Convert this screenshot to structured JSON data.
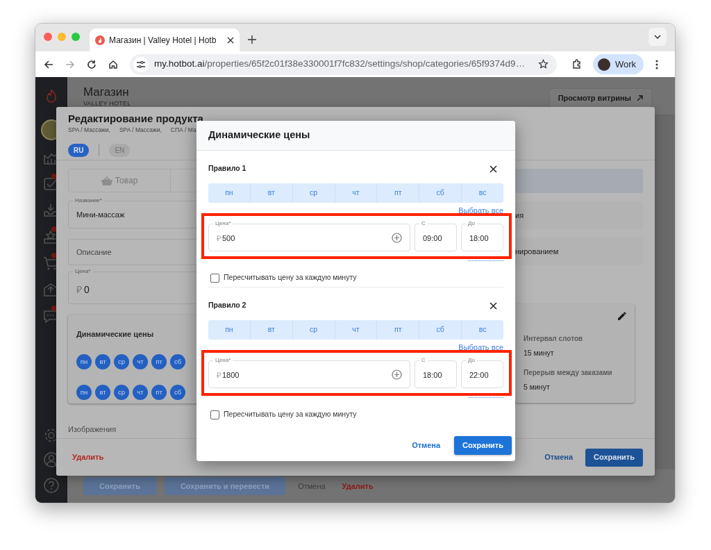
{
  "browser": {
    "tab_title": "Магазин | Valley Hotel | Hotb",
    "url_host": "my.hotbot.ai",
    "url_path": "/properties/65f2c01f38e330001f7fc832/settings/shop/categories/65f9374d9…",
    "profile": "Work"
  },
  "sidebar": {
    "items": [
      {
        "kind": "chart",
        "badge": false
      },
      {
        "kind": "check",
        "badge": true
      },
      {
        "kind": "inbox",
        "badge": false
      },
      {
        "kind": "star",
        "badge": true
      },
      {
        "kind": "cart",
        "badge": true
      },
      {
        "kind": "outbox",
        "badge": false
      },
      {
        "kind": "chat",
        "badge": true
      }
    ]
  },
  "page": {
    "title": "Магазин",
    "subtitle": "VALLEY HOTEL",
    "storefront_button": "Просмотр витрины",
    "actions": [
      {
        "label": "Сохранить",
        "kind": "primary"
      },
      {
        "label": "Сохранить и перевести",
        "kind": "primary"
      },
      {
        "label": "Отмена",
        "kind": "plain"
      },
      {
        "label": "Удалить",
        "kind": "danger"
      }
    ]
  },
  "edit_modal": {
    "title": "Редактирование продукта",
    "breadcrumbs": [
      "SPA / Массажи,",
      "SPA / Массажи,",
      "СПА / Ма"
    ],
    "languages": [
      {
        "label": "RU",
        "selected": true
      },
      {
        "label": "EN",
        "selected": false
      }
    ],
    "tab": "Товар",
    "fields": [
      {
        "label": "Название*",
        "value": "Мини-массаж"
      },
      {
        "placeholder": "Описание"
      },
      {
        "label": "Цена*",
        "currency": "₽",
        "value": "0"
      }
    ],
    "dynamic_prices": {
      "title": "Динамические цены",
      "rows": [
        [
          "пн",
          "вт",
          "ср",
          "чт",
          "пт",
          "сб"
        ],
        [
          "пн",
          "вт",
          "ср",
          "чт",
          "пт",
          "сб"
        ]
      ]
    },
    "right_fields": [
      "ия",
      "нированием"
    ],
    "booking": [
      {
        "label": "Интервал слотов",
        "value": "15 минут"
      },
      {
        "label": "Перерыв между заказами",
        "value": "5 минут"
      }
    ],
    "images_label": "Изображения",
    "delete": "Удалить",
    "cancel": "Отмена",
    "save": "Сохранить"
  },
  "dialog": {
    "title": "Динамические цены",
    "rules": [
      {
        "title": "Правило 1",
        "days": [
          {
            "label": "пн",
            "selected": true
          },
          {
            "label": "вт",
            "selected": true
          },
          {
            "label": "ср",
            "selected": true
          },
          {
            "label": "чт",
            "selected": true
          },
          {
            "label": "пт",
            "selected": true
          },
          {
            "label": "сб",
            "selected": true
          },
          {
            "label": "вс",
            "selected": true
          }
        ],
        "select_all": "Выбрать все",
        "price": {
          "label": "Цена*",
          "currency": "₽",
          "value": "500"
        },
        "from": {
          "label": "С",
          "value": "09:00"
        },
        "to": {
          "label": "До",
          "value": "18:00"
        },
        "recalc": {
          "label": "Пересчитывать цену за каждую минуту",
          "checked": false
        },
        "highlighted": true
      },
      {
        "title": "Правило 2",
        "days": [
          {
            "label": "пн",
            "selected": true
          },
          {
            "label": "вт",
            "selected": true
          },
          {
            "label": "ср",
            "selected": true
          },
          {
            "label": "чт",
            "selected": true
          },
          {
            "label": "пт",
            "selected": true
          },
          {
            "label": "сб",
            "selected": true
          },
          {
            "label": "вс",
            "selected": true
          }
        ],
        "select_all": "Выбрать все",
        "price": {
          "label": "Цена*",
          "currency": "₽",
          "value": "1800"
        },
        "from": {
          "label": "С",
          "value": "18:00"
        },
        "to": {
          "label": "До",
          "value": "22:00"
        },
        "recalc": {
          "label": "Пересчитывать цену за каждую минуту",
          "checked": false
        },
        "highlighted": true
      }
    ],
    "cancel": "Отмена",
    "save": "Сохранить"
  }
}
